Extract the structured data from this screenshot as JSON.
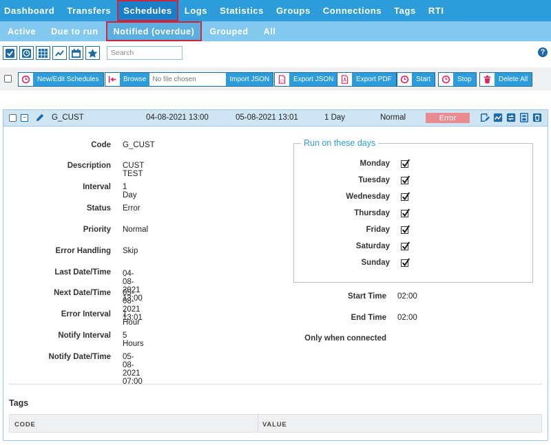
{
  "topnav": [
    "Dashboard",
    "Transfers",
    "Schedules",
    "Logs",
    "Statistics",
    "Groups",
    "Connections",
    "Tags",
    "RTI"
  ],
  "subnav": [
    "Active",
    "Due to run",
    "Notified (overdue)",
    "Grouped",
    "All"
  ],
  "toolbar": {
    "search_placeholder": "Search",
    "help": "?",
    "buttons": {
      "new_edit": "New/Edit Schedules",
      "browse": "Browse",
      "file_name": "No file chosen",
      "import": "Import JSON",
      "export_json": "Export JSON",
      "export_pdf": "Export PDF",
      "start": "Start",
      "stop": "Stop",
      "delete_all": "Delete All"
    }
  },
  "schedule": {
    "code": "G_CUST",
    "last": "04-08-2021 13:00",
    "next": "05-08-2021 13:01",
    "interval": "1 Day",
    "priority": "Normal",
    "status": "Error"
  },
  "details": {
    "labels": {
      "code": "Code",
      "description": "Description",
      "interval": "Interval",
      "status": "Status",
      "priority": "Priority",
      "error_handling": "Error Handling",
      "last": "Last Date/Time",
      "next": "Next Date/Time",
      "error_interval": "Error Interval",
      "notify_interval": "Notify Interval",
      "notify_date": "Notify Date/Time"
    },
    "values": {
      "code": "G_CUST",
      "description": "CUST TEST",
      "interval": "1 Day",
      "status": "Error",
      "priority": "Normal",
      "error_handling": "Skip",
      "last": "04-08-2021 13:00",
      "next": "05-08-2021 13:01",
      "error_interval": "1 Hour",
      "notify_interval": "5 Hours",
      "notify_date": "05-08-2021 07:00"
    }
  },
  "run_days": {
    "legend": "Run on these days",
    "days": [
      "Monday",
      "Tuesday",
      "Wednesday",
      "Thursday",
      "Friday",
      "Saturday",
      "Sunday"
    ]
  },
  "timing": {
    "start_label": "Start Time",
    "start_value": "02:00",
    "end_label": "End Time",
    "end_value": "02:00",
    "only_connected": "Only when connected"
  },
  "tags": {
    "title": "Tags",
    "col_code": "CODE",
    "col_value": "VALUE"
  },
  "colors": {
    "nav": "#2d9cdb",
    "subnav": "#83c8ee",
    "error": "#e88c92",
    "highlight": "#d0243a"
  }
}
